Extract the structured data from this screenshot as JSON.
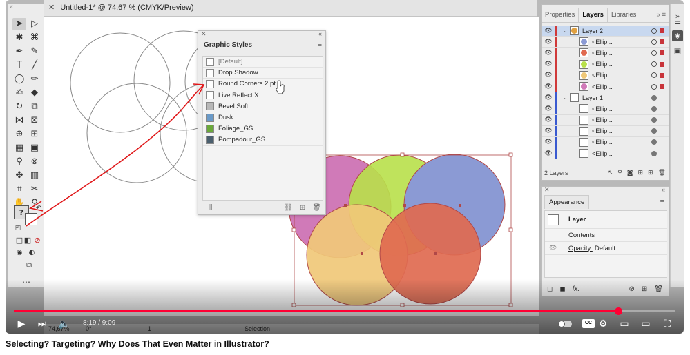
{
  "document": {
    "tab_title": "Untitled-1* @ 74,67 % (CMYK/Preview)"
  },
  "graphic_styles": {
    "title": "Graphic Styles",
    "items": [
      {
        "label": "[Default]",
        "swatch": "#ffffff",
        "muted": true
      },
      {
        "label": "Drop Shadow",
        "swatch": "#ffffff",
        "muted": false
      },
      {
        "label": "Round Corners 2 pt",
        "swatch": "#ffffff",
        "muted": false
      },
      {
        "label": "Live Reflect X",
        "swatch": "#ffffff",
        "muted": false
      },
      {
        "label": "Bevel Soft",
        "swatch": "#b8b8b8",
        "muted": false
      },
      {
        "label": "Dusk",
        "swatch": "#6a9ac8",
        "muted": false
      },
      {
        "label": "Foliage_GS",
        "swatch": "#6aa83a",
        "muted": false
      },
      {
        "label": "Pompadour_GS",
        "swatch": "#4b5f6e",
        "muted": false
      }
    ]
  },
  "layers_panel": {
    "tabs": [
      "Properties",
      "Layers",
      "Libraries"
    ],
    "active_tab": "Layers",
    "rows": [
      {
        "name": "Layer 2",
        "type": "layer",
        "selected": true,
        "bar": "#d03a3a",
        "swatch": "#e0a040",
        "square": "#c8343a"
      },
      {
        "name": "<Ellip...",
        "type": "item",
        "selected": false,
        "bar": "#d03a3a",
        "swatch": "#8b9ad4",
        "square": "#c8343a"
      },
      {
        "name": "<Ellip...",
        "type": "item",
        "selected": false,
        "bar": "#d03a3a",
        "swatch": "#e06a50",
        "square": "#c8343a"
      },
      {
        "name": "<Ellip...",
        "type": "item",
        "selected": false,
        "bar": "#d03a3a",
        "swatch": "#b8e04a",
        "square": "#c8343a"
      },
      {
        "name": "<Ellip...",
        "type": "item",
        "selected": false,
        "bar": "#d03a3a",
        "swatch": "#f0c878",
        "square": "#c8343a"
      },
      {
        "name": "<Ellip...",
        "type": "item",
        "selected": false,
        "bar": "#d03a3a",
        "swatch": "#d07ab8",
        "square": "#c8343a"
      },
      {
        "name": "Layer 1",
        "type": "layer",
        "selected": false,
        "bar": "#3a5ad0",
        "swatch": "#ffffff",
        "square": ""
      },
      {
        "name": "<Ellip...",
        "type": "item",
        "selected": false,
        "bar": "#3a5ad0",
        "swatch": "#ffffff",
        "square": ""
      },
      {
        "name": "<Ellip...",
        "type": "item",
        "selected": false,
        "bar": "#3a5ad0",
        "swatch": "#ffffff",
        "square": ""
      },
      {
        "name": "<Ellip...",
        "type": "item",
        "selected": false,
        "bar": "#3a5ad0",
        "swatch": "#ffffff",
        "square": ""
      },
      {
        "name": "<Ellip...",
        "type": "item",
        "selected": false,
        "bar": "#3a5ad0",
        "swatch": "#ffffff",
        "square": ""
      },
      {
        "name": "<Ellip...",
        "type": "item",
        "selected": false,
        "bar": "#3a5ad0",
        "swatch": "#ffffff",
        "square": ""
      }
    ],
    "footer_count": "2 Layers"
  },
  "appearance": {
    "title": "Appearance",
    "target": "Layer",
    "contents": "Contents",
    "opacity_label": "Opacity:",
    "opacity_value": "Default",
    "fx": "fx."
  },
  "status": {
    "zoom": "74,67%",
    "rotation": "0°",
    "artboard": "1",
    "tool": "Selection"
  },
  "toolbar": {
    "help_badge": "?"
  },
  "video": {
    "time": "8:19 / 9:09",
    "progress": 0.9136,
    "title": "Selecting? Targeting? Why Does That Even Matter in Illustrator?"
  },
  "colors": {
    "annotation": "#e0181a",
    "progress": "#ff0033"
  }
}
